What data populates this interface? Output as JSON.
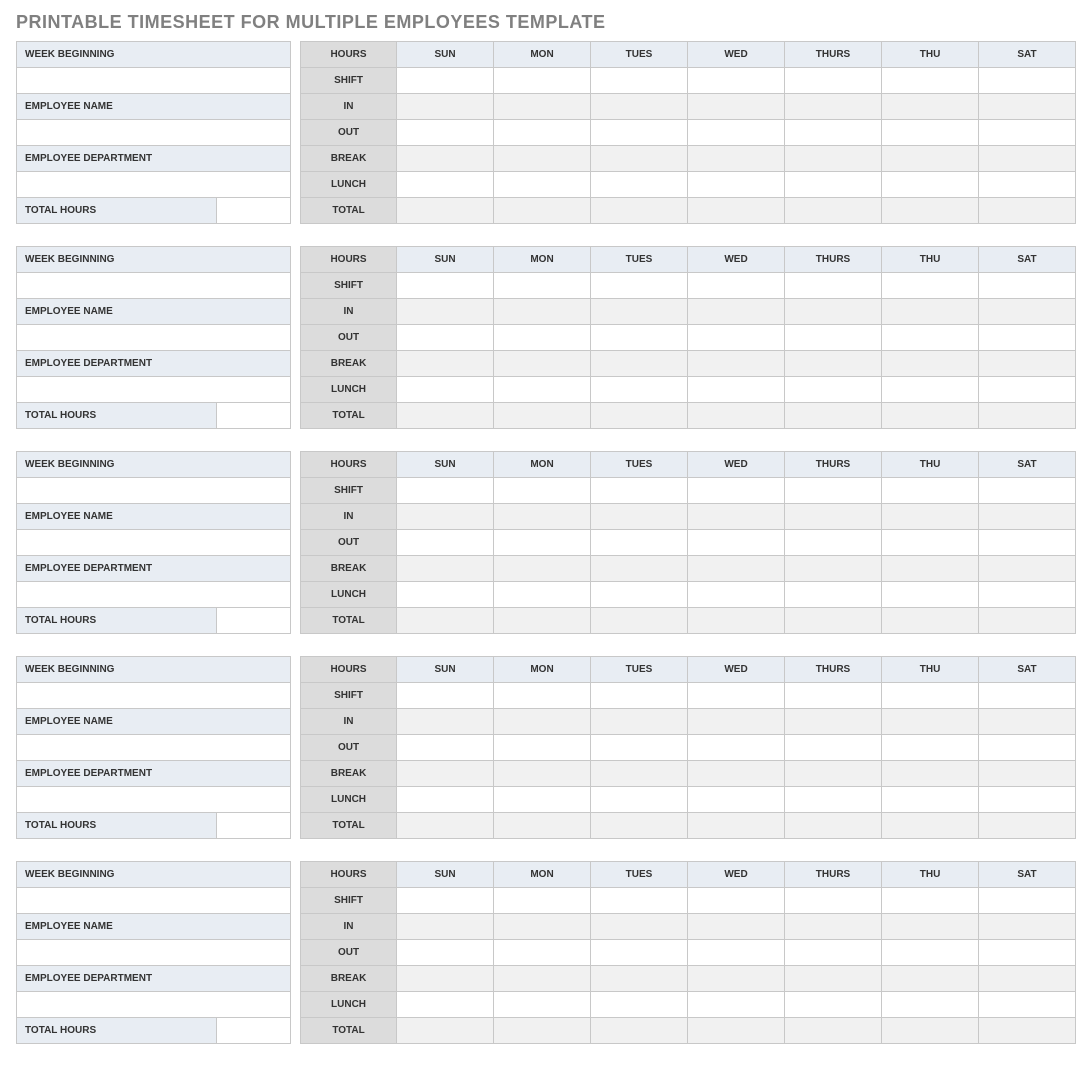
{
  "title": "PRINTABLE TIMESHEET FOR MULTIPLE EMPLOYEES TEMPLATE",
  "labels": {
    "week_beginning": "WEEK BEGINNING",
    "employee_name": "EMPLOYEE NAME",
    "employee_department": "EMPLOYEE DEPARTMENT",
    "total_hours": "TOTAL HOURS",
    "hours": "HOURS",
    "shift": "SHIFT",
    "in": "IN",
    "out": "OUT",
    "break": "BREAK",
    "lunch": "LUNCH",
    "total": "TOTAL"
  },
  "days": [
    "SUN",
    "MON",
    "TUES",
    "WED",
    "THURS",
    "THU",
    "SAT"
  ],
  "block_count": 5
}
